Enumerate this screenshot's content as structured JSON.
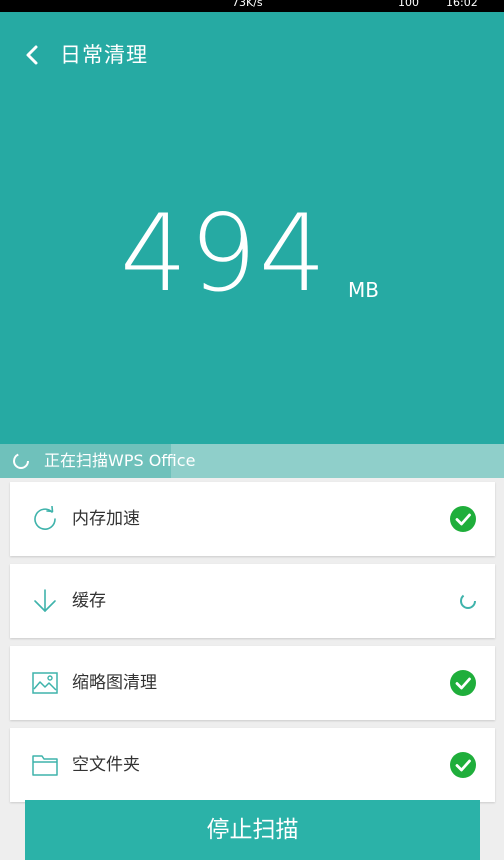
{
  "status_bar": {
    "speed": "73K/s",
    "battery": "100",
    "time": "16:02"
  },
  "app_bar": {
    "title": "日常清理",
    "back_icon": "chevron-left-icon"
  },
  "scan_result": {
    "size_value": "494",
    "size_unit": "MB"
  },
  "scan_status": {
    "text": "正在扫描WPS Office",
    "progress_fraction": 0.34
  },
  "categories": [
    {
      "label": "内存加速",
      "icon": "refresh-icon",
      "status": "done"
    },
    {
      "label": "缓存",
      "icon": "download-arrow-icon",
      "status": "scanning"
    },
    {
      "label": "缩略图清理",
      "icon": "image-icon",
      "status": "done"
    },
    {
      "label": "空文件夹",
      "icon": "folder-icon",
      "status": "done"
    }
  ],
  "colors": {
    "primary_teal": "#26aaa3",
    "check_green": "#1fae3b"
  },
  "actions": {
    "stop_label": "停止扫描"
  }
}
